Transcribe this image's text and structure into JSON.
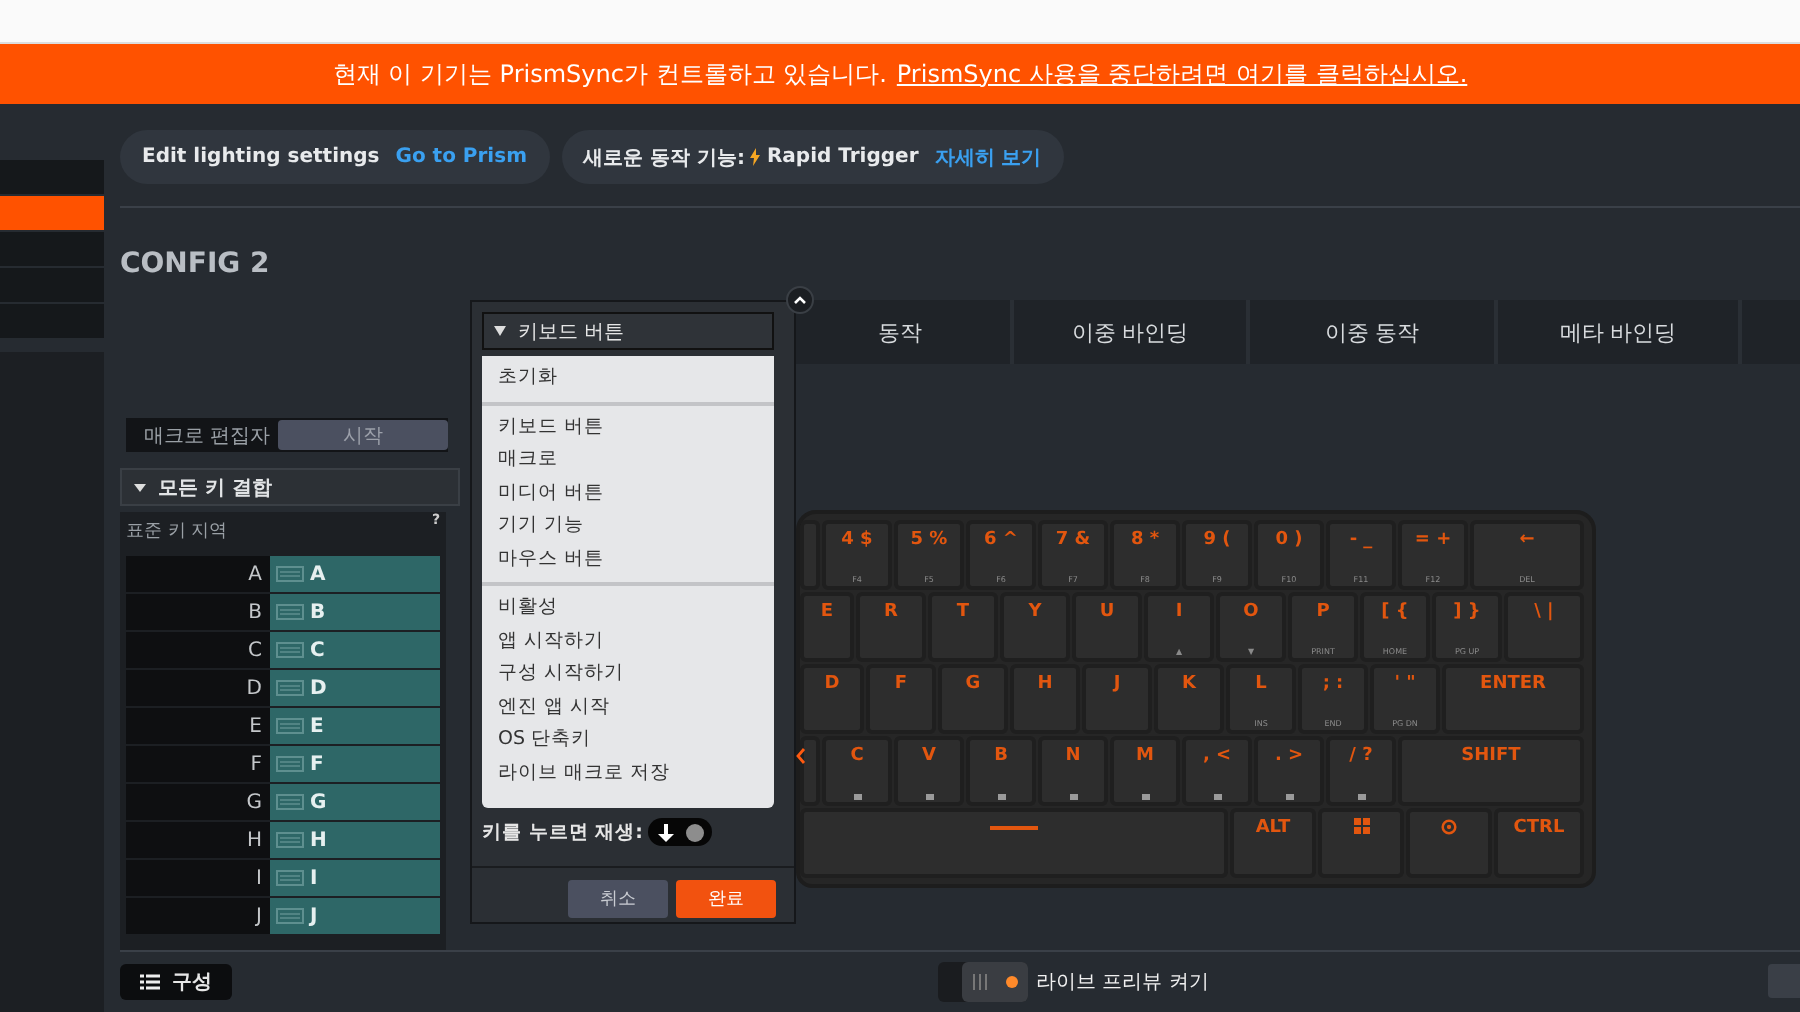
{
  "banner": {
    "text": "현재 이 기기는 PrismSync가 컨트롤하고 있습니다.",
    "link": "PrismSync 사용을 중단하려면 여기를 클릭하십시오."
  },
  "sidebar": {
    "items": [
      {
        "selected": false
      },
      {
        "selected": true
      },
      {
        "selected": false
      },
      {
        "selected": false
      },
      {
        "selected": false
      }
    ]
  },
  "notices": [
    {
      "label": "Edit lighting settings",
      "link": "Go to Prism"
    },
    {
      "label": "새로운 동작 기능:",
      "highlight": "Rapid Trigger",
      "link": "자세히 보기"
    }
  ],
  "config_title": "CONFIG 2",
  "tabs": [
    "동작",
    "이중 바인딩",
    "이중 동작",
    "메타 바인딩"
  ],
  "macro_editor": {
    "label": "매크로 편집자",
    "button": "시작"
  },
  "key_group": {
    "label": "모든 키 결합",
    "expanded": true
  },
  "key_area": {
    "title": "표준 키 지역",
    "help": "?",
    "rows": [
      {
        "key": "A",
        "binding": "A"
      },
      {
        "key": "B",
        "binding": "B"
      },
      {
        "key": "C",
        "binding": "C"
      },
      {
        "key": "D",
        "binding": "D"
      },
      {
        "key": "E",
        "binding": "E"
      },
      {
        "key": "F",
        "binding": "F"
      },
      {
        "key": "G",
        "binding": "G"
      },
      {
        "key": "H",
        "binding": "H"
      },
      {
        "key": "I",
        "binding": "I"
      },
      {
        "key": "J",
        "binding": "J"
      }
    ]
  },
  "popup": {
    "dropdown": "키보드 버튼",
    "sections": [
      [
        "초기화"
      ],
      [
        "키보드 버튼",
        "매크로",
        "미디어 버튼",
        "기기 기능",
        "마우스 버튼"
      ],
      [
        "비활성",
        "앱 시작하기",
        "구성 시작하기",
        "엔진 앱 시작",
        "OS 단축키",
        "라이브 매크로 저장"
      ]
    ],
    "playback_label": "키를 누르면 재생:",
    "playback_on": true,
    "buttons": [
      {
        "label": "취소",
        "kind": "secondary"
      },
      {
        "label": "완료",
        "kind": "primary"
      }
    ]
  },
  "keyboard": {
    "rows": [
      {
        "keys": [
          {
            "kind": "stub"
          },
          {
            "kind": "text",
            "label": "4 $",
            "sub": "F4"
          },
          {
            "kind": "text",
            "label": "5 %",
            "sub": "F5"
          },
          {
            "kind": "text",
            "label": "6 ^",
            "sub": "F6"
          },
          {
            "kind": "text",
            "label": "7 &",
            "sub": "F7"
          },
          {
            "kind": "text",
            "label": "8 *",
            "sub": "F8"
          },
          {
            "kind": "text",
            "label": "9 (",
            "sub": "F9"
          },
          {
            "kind": "text",
            "label": "0 )",
            "sub": "F10"
          },
          {
            "kind": "text",
            "label": "- _",
            "sub": "F11"
          },
          {
            "kind": "text",
            "label": "= +",
            "sub": "F12"
          },
          {
            "kind": "text",
            "label": "←",
            "sub": "DEL"
          }
        ]
      },
      {
        "keys": [
          {
            "kind": "text",
            "label": "E"
          },
          {
            "kind": "text",
            "label": "R"
          },
          {
            "kind": "text",
            "label": "T"
          },
          {
            "kind": "text",
            "label": "Y"
          },
          {
            "kind": "text",
            "label": "U"
          },
          {
            "kind": "text",
            "label": "I",
            "sub": "▲"
          },
          {
            "kind": "text",
            "label": "O",
            "sub": "▼"
          },
          {
            "kind": "text",
            "label": "P",
            "sub": "PRINT"
          },
          {
            "kind": "text",
            "label": "[ {",
            "sub": "HOME"
          },
          {
            "kind": "text",
            "label": "] }",
            "sub": "PG UP"
          },
          {
            "kind": "text",
            "label": "\\ |"
          }
        ]
      },
      {
        "keys": [
          {
            "kind": "text",
            "label": "D"
          },
          {
            "kind": "text",
            "label": "F"
          },
          {
            "kind": "text",
            "label": "G"
          },
          {
            "kind": "text",
            "label": "H"
          },
          {
            "kind": "text",
            "label": "J"
          },
          {
            "kind": "text",
            "label": "K"
          },
          {
            "kind": "text",
            "label": "L",
            "sub": "INS"
          },
          {
            "kind": "text",
            "label": "; :",
            "sub": "END"
          },
          {
            "kind": "text",
            "label": "' \"",
            "sub": "PG DN"
          },
          {
            "kind": "text",
            "label": "ENTER"
          }
        ]
      },
      {
        "keys": [
          {
            "kind": "stub"
          },
          {
            "kind": "text",
            "label": "C",
            "mark": true
          },
          {
            "kind": "text",
            "label": "V",
            "mark": true
          },
          {
            "kind": "text",
            "label": "B",
            "mark": true
          },
          {
            "kind": "text",
            "label": "N",
            "mark": true
          },
          {
            "kind": "text",
            "label": "M",
            "mark": true
          },
          {
            "kind": "text",
            "label": ", <",
            "mark": true
          },
          {
            "kind": "text",
            "label": ". >",
            "mark": true
          },
          {
            "kind": "text",
            "label": "/ ?",
            "mark": true
          },
          {
            "kind": "text",
            "label": "SHIFT"
          }
        ]
      },
      {
        "keys": [
          {
            "kind": "space"
          },
          {
            "kind": "text",
            "label": "ALT"
          },
          {
            "kind": "windows"
          },
          {
            "kind": "logo"
          },
          {
            "kind": "text",
            "label": "CTRL"
          }
        ]
      }
    ]
  },
  "footer": {
    "config_button": "구성",
    "live_preview": "라이브 프리뷰 켜기",
    "live_preview_on": true
  }
}
